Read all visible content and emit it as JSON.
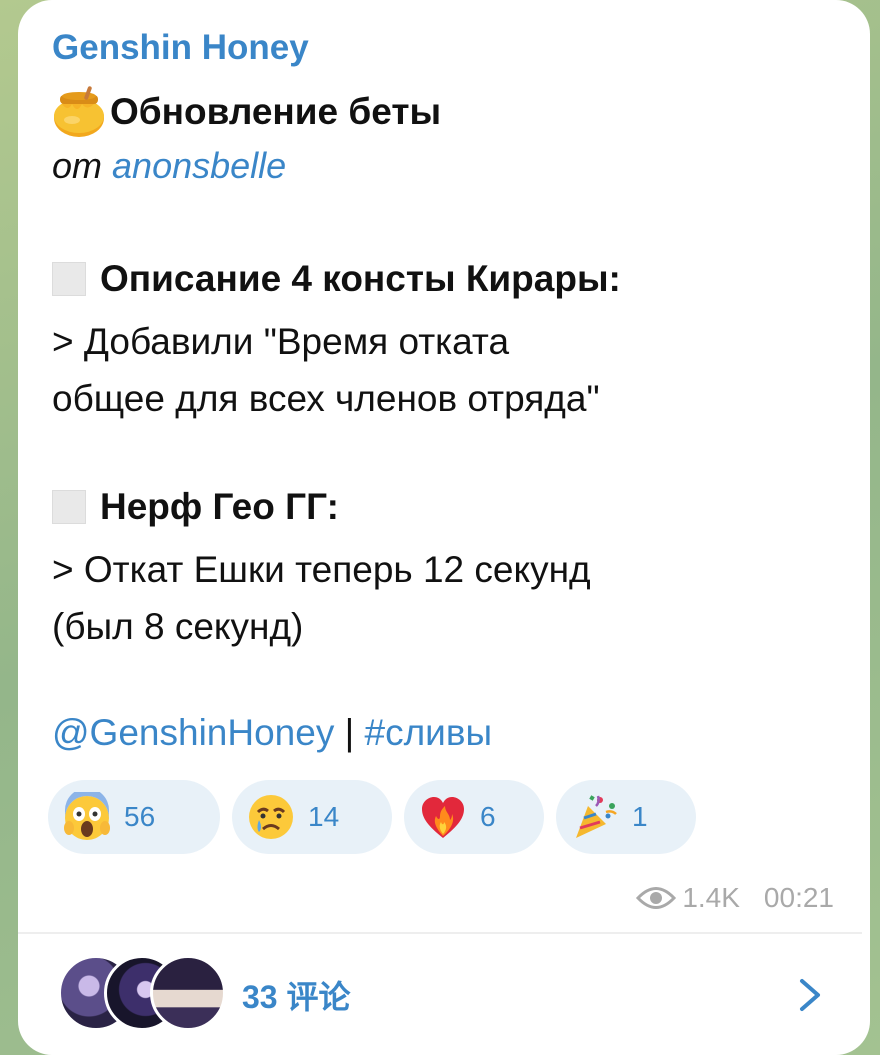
{
  "channel": {
    "name": "Genshin Honey"
  },
  "post": {
    "title": "Обновление беты",
    "from_prefix": "от",
    "from_author": "anonsbelle",
    "sections": [
      {
        "heading": "Описание 4 консты Кирары:",
        "lines": [
          "> Добавили \"Время отката",
          "общее для всех членов отряда\""
        ]
      },
      {
        "heading": "Нерф Гео ГГ:",
        "lines": [
          "> Откат Ешки теперь 12 секунд",
          "(был 8 секунд)"
        ]
      }
    ],
    "tag_channel": "@GenshinHoney",
    "tag_separator": "|",
    "tag_hashtag": "#сливы"
  },
  "reactions": [
    {
      "icon": "screaming-face-icon",
      "count": "56"
    },
    {
      "icon": "crying-face-icon",
      "count": "14"
    },
    {
      "icon": "heart-on-fire-icon",
      "count": "6"
    },
    {
      "icon": "party-popper-icon",
      "count": "1"
    }
  ],
  "meta": {
    "views": "1.4K",
    "time": "00:21"
  },
  "comments": {
    "label": "33 评论"
  },
  "colors": {
    "accent": "#3a86c8",
    "reaction_bg": "#e8f1f8",
    "meta_text": "#a9a9a9"
  }
}
